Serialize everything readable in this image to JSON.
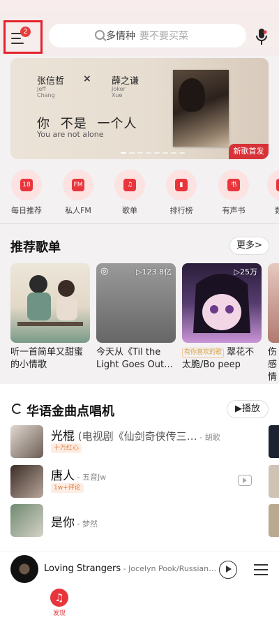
{
  "header": {
    "menu_badge": "2",
    "search_hot": "多情种",
    "search_hint": "要不要买菜"
  },
  "banner": {
    "artist1": "张信哲",
    "artist1_en_1": "Jeff",
    "artist1_en_2": "Chang",
    "cross": "×",
    "artist2": "薛之谦",
    "artist2_en_1": "Joker",
    "artist2_en_2": "Xue",
    "title": "你 不是 一个人",
    "subtitle": "You are not alone",
    "badge": "新歌首发"
  },
  "quick_nav": [
    {
      "label": "每日推荐",
      "icon": "calendar-icon",
      "glyph": "18"
    },
    {
      "label": "私人FM",
      "icon": "radio-icon",
      "glyph": "FM"
    },
    {
      "label": "歌单",
      "icon": "playlist-icon",
      "glyph": "♫"
    },
    {
      "label": "排行榜",
      "icon": "chart-icon",
      "glyph": "▮"
    },
    {
      "label": "有声书",
      "icon": "book-icon",
      "glyph": "书"
    },
    {
      "label": "数字",
      "icon": "digital-icon",
      "glyph": "♪"
    }
  ],
  "recommend": {
    "title": "推荐歌单",
    "more": "更多>",
    "playlists": [
      {
        "title": "听一首简单又甜蜜的小情歌",
        "count": "",
        "tag": "",
        "colors": [
          "#e8e0d4",
          "#7a9a88"
        ]
      },
      {
        "title": "今天从《Til the Light Goes Out…",
        "count": "▷123.8亿",
        "tag": "",
        "colors": [
          "#8b8b8b",
          "#5e5e5e"
        ]
      },
      {
        "title": "翠花不太脆/Bo peep",
        "count": "▷25万",
        "tag": "有你喜欢的歌",
        "colors": [
          "#2b1a3a",
          "#c58bd8"
        ]
      },
      {
        "title": "伤感情",
        "count": "",
        "tag": "",
        "colors": [
          "#e6c9c0",
          "#b07a70"
        ]
      }
    ]
  },
  "chart_section": {
    "title": "华语金曲点唱机",
    "play": "▶播放",
    "songs": [
      {
        "name": "光棍",
        "extra": " (电视剧《仙剑奇侠传三…",
        "artist": " - 胡歌",
        "tag": "十万红心",
        "colors": [
          "#d9d3cc",
          "#6d5e55"
        ]
      },
      {
        "name": "唐人",
        "extra": "",
        "artist": " - 五音Jw",
        "tag": "1w+评论",
        "colors": [
          "#3a2d26",
          "#b8a59a"
        ]
      },
      {
        "name": "是你",
        "extra": "",
        "artist": " - 梦然",
        "tag": "",
        "colors": [
          "#6f8a70",
          "#d4d1c6"
        ]
      }
    ]
  },
  "mini_player": {
    "title": "Loving Strangers",
    "artist": " - Jocelyn Pook/Russian…"
  },
  "tabbar": {
    "active_label": "发现"
  },
  "colors": {
    "accent": "#e8353b",
    "highlight_box": "#e3222d"
  }
}
